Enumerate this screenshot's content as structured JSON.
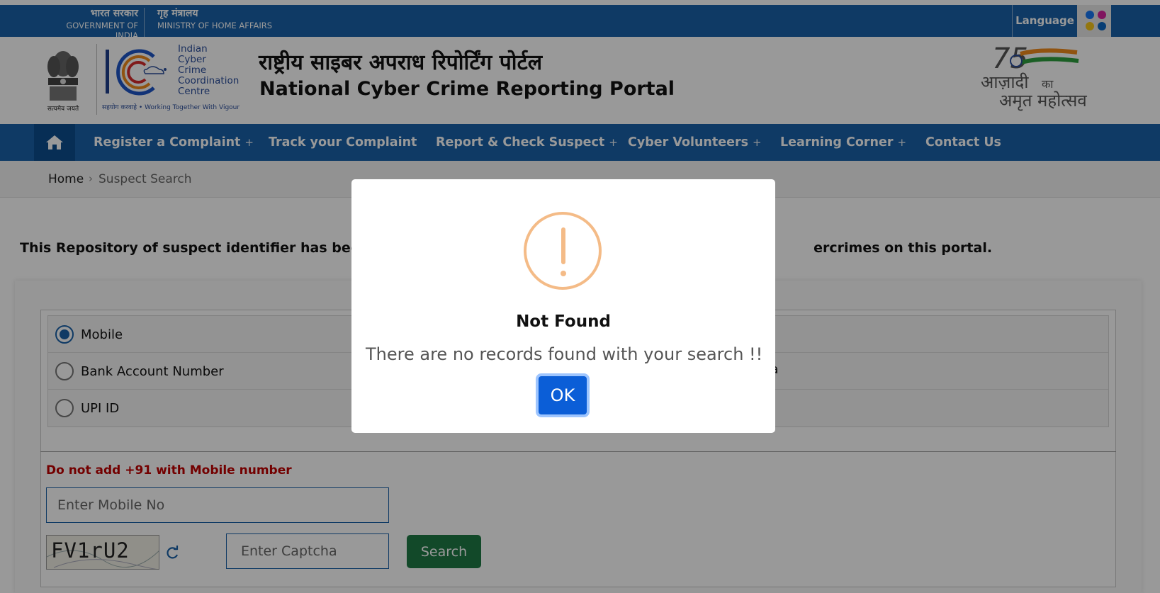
{
  "gov_bar": {
    "gov_hi": "भारत सरकार",
    "gov_en": "GOVERNMENT OF INDIA",
    "ministry_hi": "गृह मंत्रालय",
    "ministry_en": "MINISTRY OF HOME AFFAIRS",
    "language_label": "Language",
    "social_icons": [
      "facebook-icon",
      "instagram-icon",
      "koo-icon",
      "linkedin-icon"
    ]
  },
  "header": {
    "emblem_caption": "सत्यमेव जयते",
    "i4c_lines": [
      "Indian",
      "Cyber",
      "Crime",
      "Coordination",
      "Centre"
    ],
    "i4c_tagline": "सहयोग करवाहे • Working Together With Vigour",
    "title_hi": "राष्ट्रीय साइबर अपराध रिपोर्टिंग पोर्टल",
    "title_en": "National Cyber Crime Reporting Portal",
    "azadi_logo_text": "आज़ादी का अमृत महोत्सव"
  },
  "nav": {
    "items": [
      {
        "label": "Register a Complaint",
        "has_submenu": "+"
      },
      {
        "label": "Track your Complaint",
        "has_submenu": ""
      },
      {
        "label": "Report & Check Suspect",
        "has_submenu": "+"
      },
      {
        "label": "Cyber Volunteers",
        "has_submenu": "+"
      },
      {
        "label": "Learning Corner",
        "has_submenu": "+"
      },
      {
        "label": "Contact Us",
        "has_submenu": ""
      }
    ]
  },
  "breadcrumb": {
    "home": "Home",
    "separator": "›",
    "current": "Suspect Search"
  },
  "intro": {
    "text_left": "This Repository of suspect identifier has been crea",
    "text_right": "ercrimes on this portal."
  },
  "search_form": {
    "options": [
      {
        "label": "Mobile",
        "selected": true
      },
      {
        "label": "Bank Account Number",
        "selected": false
      },
      {
        "label": "UPI ID",
        "selected": false
      }
    ],
    "hidden_option_fragment": "edia",
    "warning": "Do not add +91 with Mobile number",
    "mobile_placeholder": "Enter Mobile No",
    "captcha_text": "FV1rU2",
    "captcha_placeholder": "Enter Captcha",
    "search_label": "Search"
  },
  "modal": {
    "icon": "exclamation-icon",
    "title": "Not Found",
    "message": "There are no records found with your search !!",
    "ok_label": "OK"
  },
  "colors": {
    "primary_blue": "#1a62a8",
    "warning_red": "#c00000",
    "search_green": "#1f7a45",
    "ok_blue": "#0b5ed7",
    "alert_orange": "#f4bb87"
  }
}
